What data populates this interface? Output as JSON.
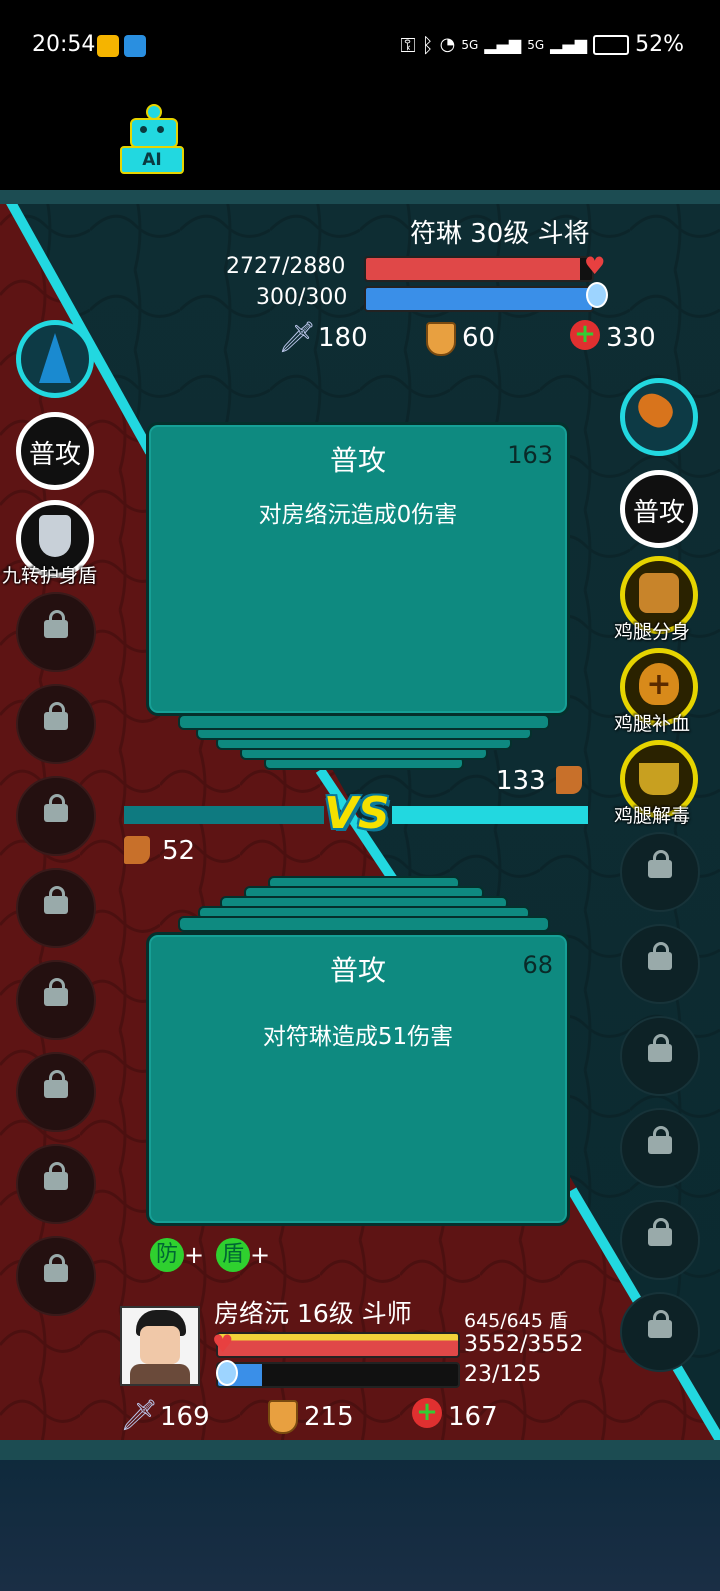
{
  "status_bar": {
    "time": "20:54",
    "battery": "52%",
    "signal1": "5G",
    "signal2": "5G"
  },
  "ai_badge": "AI",
  "enemy": {
    "name_line": "符琳 30级 斗将",
    "hp_text": "2727/2880",
    "hp_fraction": 0.947,
    "mp_text": "300/300",
    "mp_fraction": 1.0,
    "attack": "180",
    "defense": "60",
    "health_regen": "330"
  },
  "enemy_card": {
    "title": "普攻",
    "number": "163",
    "text": "对房络沅造成0伤害"
  },
  "player_card": {
    "title": "普攻",
    "number": "68",
    "text": "对符琳造成51伤害"
  },
  "speed": {
    "enemy": "133",
    "player": "52"
  },
  "vs_label": "VS",
  "left_skills": {
    "basic": "普攻",
    "shield_label": "九转护身盾"
  },
  "right_skills": {
    "basic": "普攻",
    "clone_label": "鸡腿分身",
    "heal_label": "鸡腿补血",
    "detox_label": "鸡腿解毒"
  },
  "buffs": [
    {
      "glyph": "防",
      "suffix": "+"
    },
    {
      "glyph": "盾",
      "suffix": "+"
    }
  ],
  "player": {
    "name_line": "房络沅 16级 斗师",
    "shield_text": "645/645 盾",
    "hp_text": "3552/3552",
    "hp_fraction": 1.0,
    "mp_text": "23/125",
    "mp_fraction": 0.184,
    "attack": "169",
    "defense": "215",
    "health_regen": "167"
  },
  "colors": {
    "hp": "#e04848",
    "mp": "#3a8fe8",
    "shield": "#f2d23a",
    "cyan": "#22d8e0",
    "card": "#0e8a80"
  }
}
